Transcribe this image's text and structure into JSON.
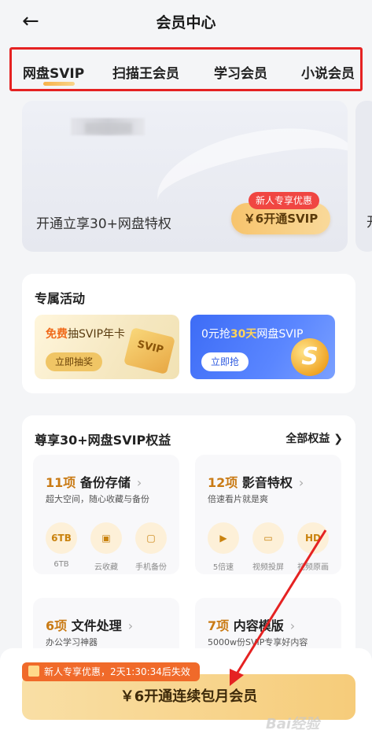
{
  "header": {
    "title": "会员中心"
  },
  "tabs": [
    "网盘SVIP",
    "扫描王会员",
    "学习会员",
    "小说会员"
  ],
  "hero": {
    "text": "开通立享30+网盘特权",
    "badge": "新人专享优惠",
    "button": "￥6开通SVIP",
    "peek_text": "开"
  },
  "activity": {
    "title": "专属活动",
    "items": [
      {
        "hl": "免费",
        "rest": "抽SVIP年卡",
        "button": "立即抽奖",
        "art": "SVIP"
      },
      {
        "pre": "0元抢",
        "hl": "30天",
        "rest": "网盘SVIP",
        "button": "立即抢",
        "art": "S"
      }
    ]
  },
  "benefits": {
    "title": "尊享30+网盘SVIP权益",
    "all": "全部权益 ❯",
    "chevron": "›",
    "groups": [
      {
        "num": "11项",
        "name": "备份存储",
        "sub": "超大空间，随心收藏与备份",
        "icons": [
          {
            "glyph": "6TB",
            "label": "6TB"
          },
          {
            "glyph": "▣",
            "label": "云收藏"
          },
          {
            "glyph": "▢",
            "label": "手机备份"
          }
        ]
      },
      {
        "num": "12项",
        "name": "影音特权",
        "sub": "倍速看片就是爽",
        "icons": [
          {
            "glyph": "▶",
            "label": "5倍速"
          },
          {
            "glyph": "▭",
            "label": "视频投屏"
          },
          {
            "glyph": "HD",
            "label": "视频原画"
          }
        ]
      },
      {
        "num": "6项",
        "name": "文件处理",
        "sub": "办公学习神器"
      },
      {
        "num": "7项",
        "name": "内容模版",
        "sub": "5000w份SVIP专享好内容"
      }
    ]
  },
  "bottom": {
    "promo": "新人专享优惠，2天1:30:34后失效",
    "cta": "￥6开通连续包月会员",
    "watermark": "Bai经验"
  },
  "colors": {
    "highlight_box": "#e52222",
    "arrow": "#e52222",
    "accent": "#f7c46d"
  }
}
